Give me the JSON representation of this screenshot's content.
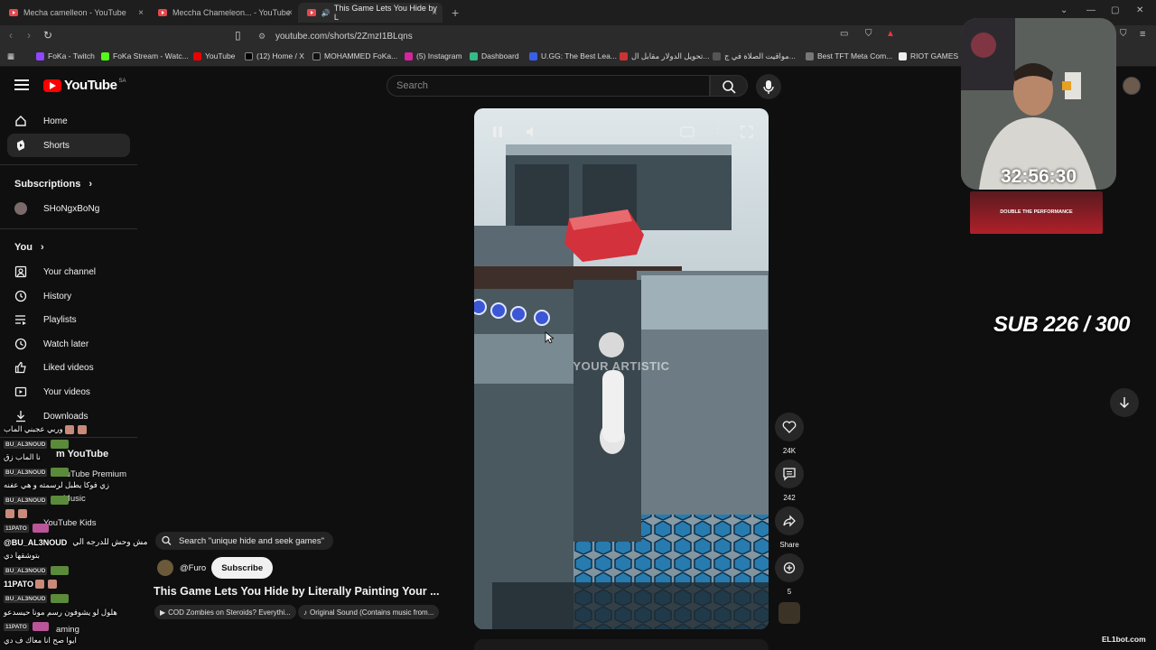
{
  "browser": {
    "tabs": [
      {
        "title": "Mecha camelleon - YouTube"
      },
      {
        "title": "Meccha Chameleon... - YouTube"
      },
      {
        "title": "This Game Lets You Hide by L"
      }
    ],
    "url": "youtube.com/shorts/2ZmzI1BLqns",
    "bookmarks": [
      "FoKa - Twitch",
      "FoKa Stream - Watc...",
      "YouTube",
      "(12) Home / X",
      "MOHAMMED FoKa...",
      "(5) Instagram",
      "Dashboard",
      "U.GG: The Best Lea...",
      "تحويل الدولار مقابل ال...",
      "مواقيت الصلاة في ج...",
      "Best TFT Meta Com...",
      "RIOT GAMES - P"
    ]
  },
  "header": {
    "logo_text": "YouTube",
    "country": "SA",
    "search_placeholder": "Search"
  },
  "sidebar": {
    "main": [
      {
        "label": "Home",
        "icon": "home-icon"
      },
      {
        "label": "Shorts",
        "icon": "shorts-icon"
      }
    ],
    "subscriptions_heading": "Subscriptions",
    "subscriptions": [
      {
        "label": "SHoNgxBoNg"
      }
    ],
    "you_heading": "You",
    "you_items": [
      {
        "label": "Your channel",
        "icon": "channel-icon"
      },
      {
        "label": "History",
        "icon": "history-icon"
      },
      {
        "label": "Playlists",
        "icon": "playlists-icon"
      },
      {
        "label": "Watch later",
        "icon": "clock-icon"
      },
      {
        "label": "Liked videos",
        "icon": "thumbs-up-icon"
      },
      {
        "label": "Your videos",
        "icon": "video-icon"
      },
      {
        "label": "Downloads",
        "icon": "download-icon"
      }
    ],
    "more_heading": "m YouTube",
    "more_items": [
      "YouTube Premium",
      "e Music",
      "YouTube Kids",
      "aming"
    ]
  },
  "chat": [
    {
      "user": "",
      "text": "وربي عجبني الماب"
    },
    {
      "user": "BU_AL3NOUD",
      "text": ""
    },
    {
      "user": "",
      "text": "نا الماب زق"
    },
    {
      "user": "BU_AL3NOUD",
      "text": ""
    },
    {
      "user": "",
      "text": "زي فوكا يطبل لرسمته و هي عفنه"
    },
    {
      "user": "BU_AL3NOUD",
      "text": ""
    },
    {
      "user": "11PATO",
      "text": ""
    },
    {
      "user": "@BU_AL3NOUD",
      "text": "مش وحش للدرجه الي"
    },
    {
      "user": "",
      "text": "بتوشقها دي"
    },
    {
      "user": "BU_AL3NOUD",
      "text": ""
    },
    {
      "user": "11PATO",
      "text": ""
    },
    {
      "user": "BU_AL3NOUD",
      "text": ""
    },
    {
      "user": "",
      "text": "هلول لو يشوفون رسم مونا حيسدعو"
    },
    {
      "user": "11PATO",
      "text": ""
    },
    {
      "user": "",
      "text": "ايوا صح انا معاك ف دي"
    }
  ],
  "short": {
    "watermark": "YOUR ARTISTIC",
    "search_chip": "Search \"unique hide and seek games\"",
    "channel": "@Furo",
    "subscribe": "Subscribe",
    "title": "This Game Lets You Hide by Literally Painting Your ...",
    "chips": [
      "COD Zombies on Steroids? Everythi...",
      "Original Sound (Contains music from..."
    ],
    "likes": "24K",
    "comments": "242",
    "share": "Share",
    "remix": "5"
  },
  "overlay": {
    "timer": "32:56:30",
    "ad_text": "DOUBLE THE PERFORMANCE",
    "sub_goal": "SUB 226 / 300",
    "bot_label": "EL1bot.com"
  }
}
